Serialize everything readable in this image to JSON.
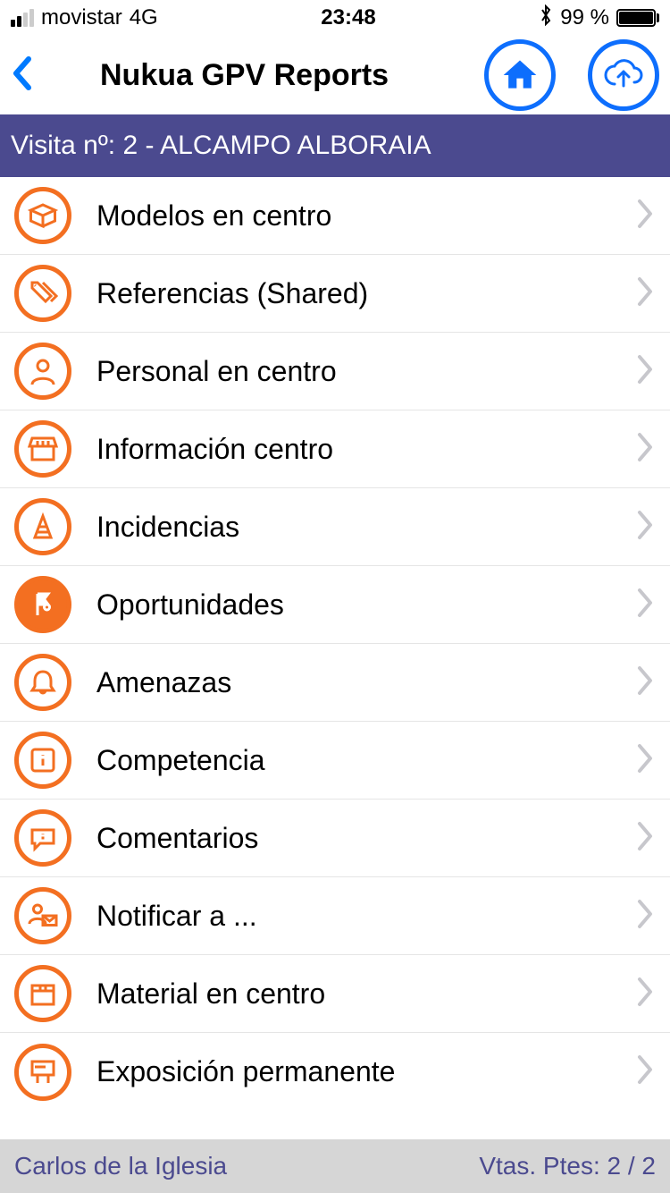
{
  "status": {
    "carrier": "movistar",
    "network": "4G",
    "time": "23:48",
    "battery_pct": "99 %"
  },
  "nav": {
    "title": "Nukua GPV Reports"
  },
  "subheader": {
    "text": "Visita nº: 2 - ALCAMPO ALBORAIA"
  },
  "items": [
    {
      "label": "Modelos en centro",
      "icon": "box-icon"
    },
    {
      "label": "Referencias (Shared)",
      "icon": "tags-icon"
    },
    {
      "label": "Personal en centro",
      "icon": "person-icon"
    },
    {
      "label": "Información centro",
      "icon": "store-icon"
    },
    {
      "label": "Incidencias",
      "icon": "cone-icon"
    },
    {
      "label": "Oportunidades",
      "icon": "flag-icon"
    },
    {
      "label": "Amenazas",
      "icon": "bell-icon"
    },
    {
      "label": "Competencia",
      "icon": "info-icon"
    },
    {
      "label": "Comentarios",
      "icon": "chat-icon"
    },
    {
      "label": "Notificar a ...",
      "icon": "mail-person-icon"
    },
    {
      "label": "Material en centro",
      "icon": "package-icon"
    },
    {
      "label": "Exposición permanente",
      "icon": "billboard-icon"
    }
  ],
  "footer": {
    "user": "Carlos de la Iglesia",
    "pending": "Vtas. Ptes: 2 / 2"
  }
}
